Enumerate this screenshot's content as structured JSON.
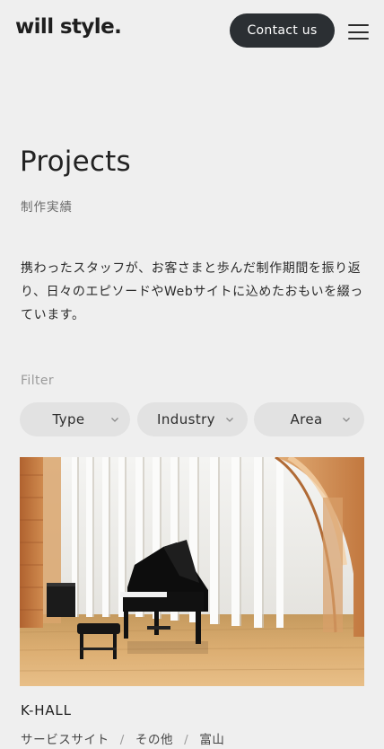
{
  "header": {
    "logo": "will style.",
    "contact_label": "Contact us",
    "menu_icon": "hamburger-icon"
  },
  "page": {
    "title": "Projects",
    "subtitle": "制作実績",
    "intro": "携わったスタッフが、お客さまと歩んだ制作期間を振り返り、日々のエピソードやWebサイトに込めたおもいを綴っています。"
  },
  "filter": {
    "label": "Filter",
    "options": [
      {
        "label": "Type",
        "icon": "chevron-down-icon"
      },
      {
        "label": "Industry",
        "icon": "chevron-down-icon"
      },
      {
        "label": "Area",
        "icon": "chevron-down-icon"
      }
    ]
  },
  "projects": [
    {
      "title": "K-HALL",
      "tags": [
        "サービスサイト",
        "その他",
        "富山"
      ],
      "image": "concert-hall-grand-piano-photo"
    }
  ]
}
